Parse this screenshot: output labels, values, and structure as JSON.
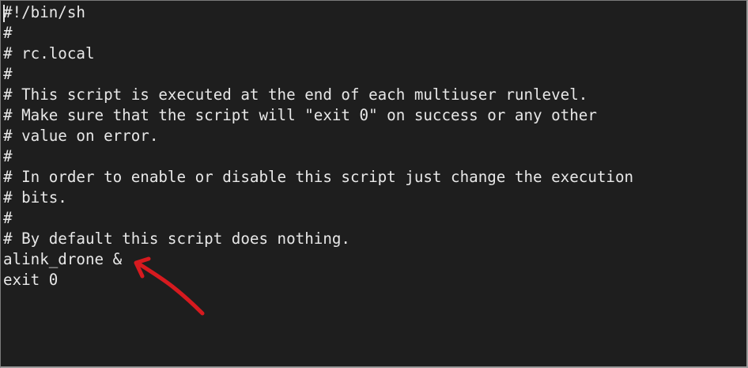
{
  "editor": {
    "lines": [
      "#!/bin/sh",
      "#",
      "# rc.local",
      "#",
      "# This script is executed at the end of each multiuser runlevel.",
      "# Make sure that the script will \"exit 0\" on success or any other",
      "# value on error.",
      "#",
      "# In order to enable or disable this script just change the execution",
      "# bits.",
      "#",
      "# By default this script does nothing.",
      "alink_drone &",
      "exit 0"
    ]
  },
  "colors": {
    "background": "#1e1e1e",
    "text": "#e8e8e8",
    "annotation": "#d61a1f"
  },
  "annotation": {
    "icon": "red-arrow-icon"
  }
}
